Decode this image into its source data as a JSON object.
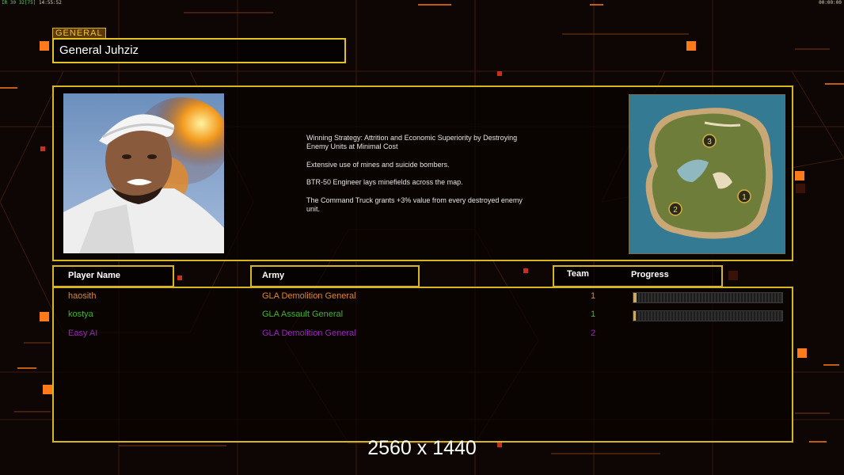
{
  "hud": {
    "top_left_a": "IR",
    "top_left_b": "30 32",
    "top_left_c": "[75]",
    "top_left_d": "14:55:52",
    "top_right": "00:00:00"
  },
  "general_tag": "GENERAL",
  "general_name": "General Juhziz",
  "strategy": [
    "Winning Strategy: Attrition and Economic Superiority by Destroying\n Enemy Units at Minimal Cost",
    "Extensive use of mines and suicide bombers.",
    "BTR-50 Engineer lays minefields across the map.",
    "The Command Truck grants +3% value from every destroyed enemy\n unit."
  ],
  "minimap": {
    "start_labels": [
      "3",
      "1",
      "2"
    ]
  },
  "headers": {
    "player": "Player Name",
    "army": "Army",
    "team": "Team",
    "progress": "Progress"
  },
  "players": [
    {
      "name": "haosith",
      "army": "GLA Demolition General",
      "team": "1",
      "color": "#e0862a",
      "progress": 0.02,
      "has_bar": true
    },
    {
      "name": "kostya",
      "army": "GLA Assault General",
      "team": "1",
      "color": "#43b22a",
      "progress": 0.01,
      "has_bar": true
    },
    {
      "name": "Easy AI",
      "army": "GLA Demolition General",
      "team": "2",
      "color": "#9a25b8",
      "progress": 0,
      "has_bar": false
    }
  ],
  "resolution": "2560 x 1440",
  "colors": {
    "accent": "#d6b61e",
    "bg": "#0d0604",
    "orange": "#ff7a1a"
  }
}
